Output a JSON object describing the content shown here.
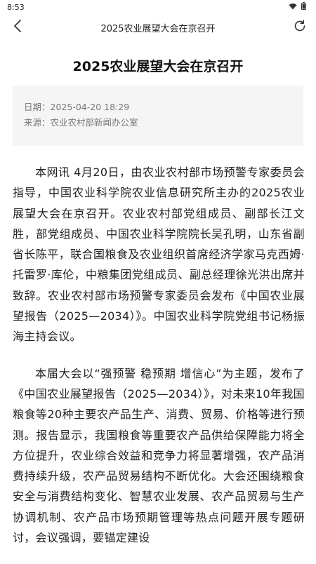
{
  "status_bar": {
    "time": "8:53"
  },
  "nav": {
    "title": "2025农业展望大会在京召开"
  },
  "article": {
    "title": "2025农业展望大会在京召开",
    "meta": {
      "date_label": "日期：",
      "date_value": "2025-04-20 18:29",
      "source_label": "来源：",
      "source_value": "农业农村部新闻办公室"
    },
    "paragraphs": [
      "本网讯 4月20日，由农业农村部市场预警专家委员会指导，中国农业科学院农业信息研究所主办的2025农业展望大会在京召开。农业农村部党组成员、副部长江文胜，部党组成员、中国农业科学院院长吴孔明，山东省副省长陈平，联合国粮食及农业组织首席经济学家马克西姆·托雷罗·库伦，中粮集团党组成员、副总经理徐光洪出席并致辞。农业农村部市场预警专家委员会发布《中国农业展望报告（2025—2034）》。中国农业科学院党组书记杨振海主持会议。",
      "本届大会以“强预警 稳预期 增信心”为主题，发布了《中国农业展望报告（2025—2034）》，对未来10年我国粮食等20种主要农产品生产、消费、贸易、价格等进行预测。报告显示，我国粮食等重要农产品供给保障能力将全方位提升，农业综合效益和竞争力将显著增强，农产品消费持续升级，农产品贸易结构不断优化。大会还围绕粮食安全与消费结构变化、智慧农业发展、农产品贸易与生产协调机制、农产品市场预期管理等热点问题开展专题研讨，会议强调，要锚定建设"
    ]
  }
}
